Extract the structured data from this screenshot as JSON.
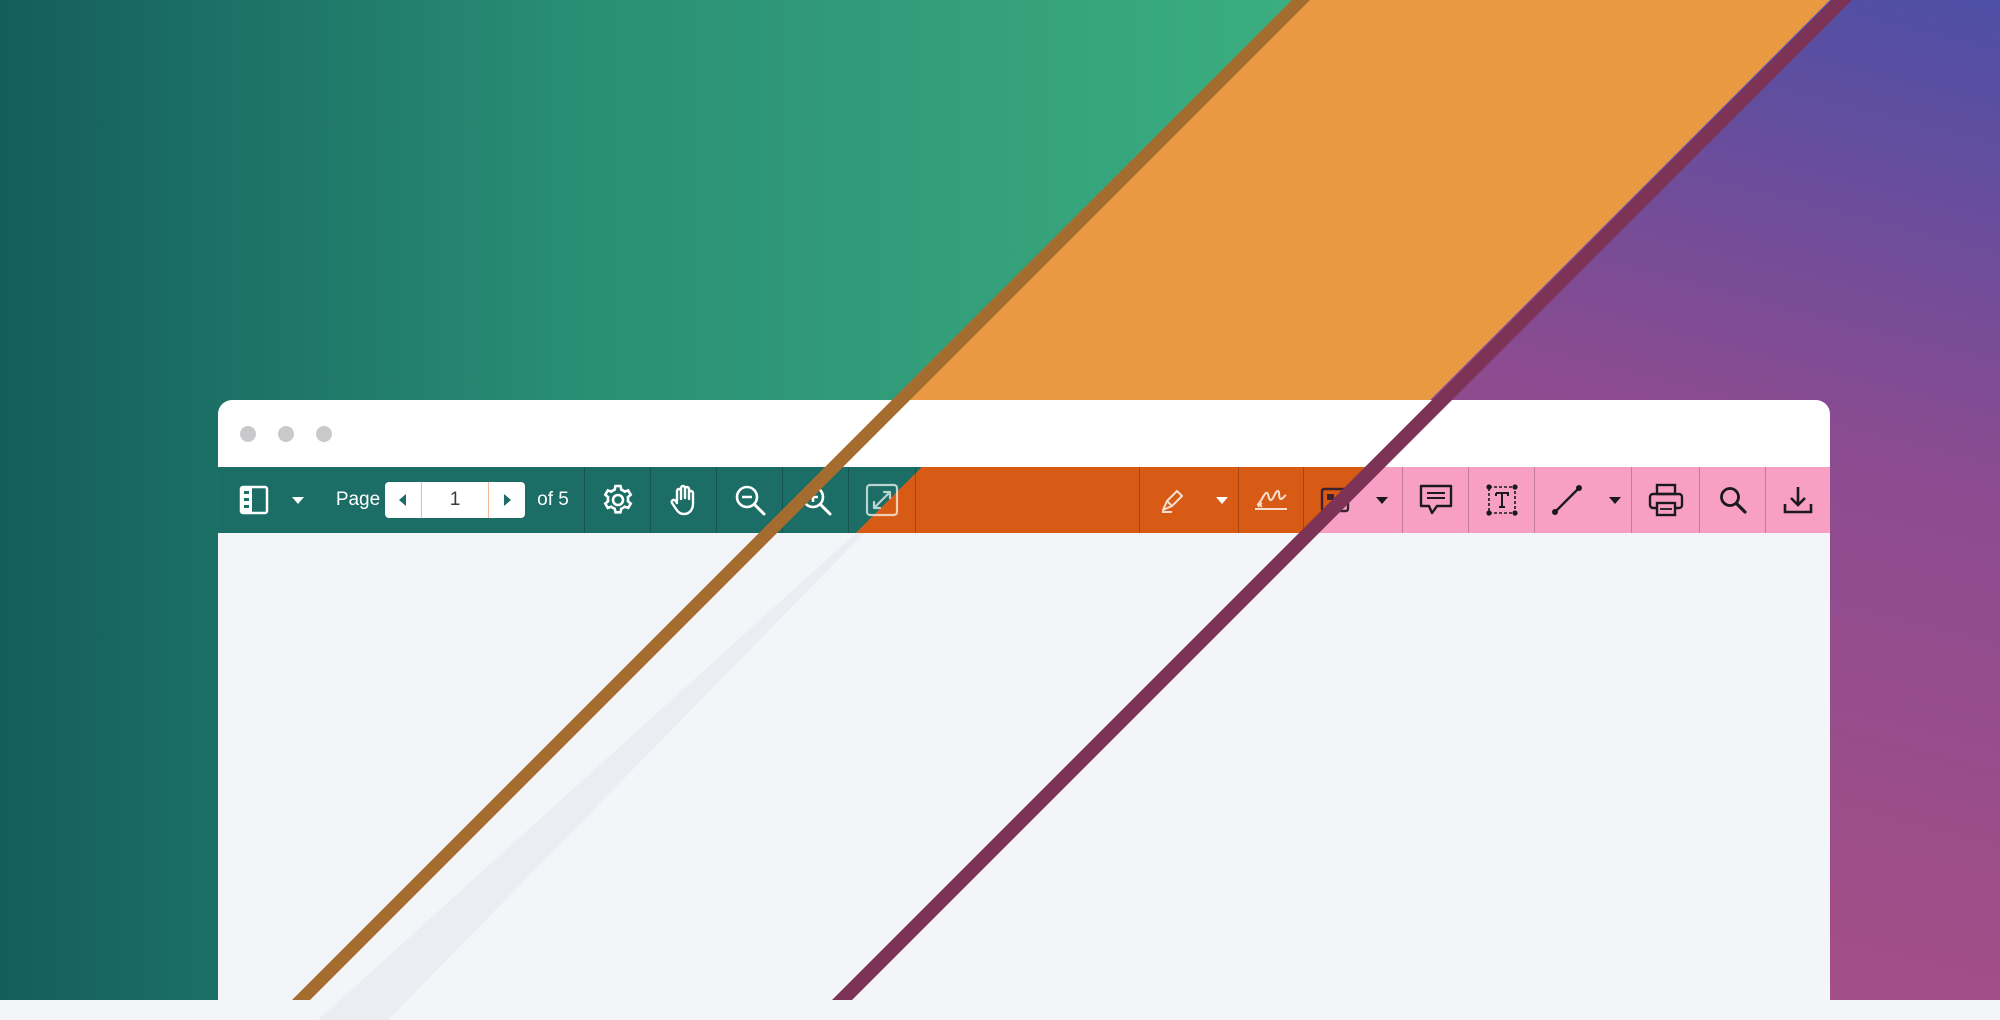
{
  "colors": {
    "teal_dark": "#145d5c",
    "teal_mid": "#2a8f75",
    "teal_light": "#3cae80",
    "orange_band": "#e99941",
    "orange_toolbar": "#d75b14",
    "purple": "#564aa2",
    "magenta": "#9a4b8a",
    "pink_toolbar": "#f8a0c4",
    "window_white": "#ffffff",
    "content_bg": "#f4f5f9",
    "stripe_brown": "#a56c30",
    "stripe_plum": "#7c3355",
    "window_dots": "#c9c9cc"
  },
  "toolbar": {
    "sidebar_toggle_icon": "sidebar-panel-icon",
    "sidebar_menu_icon": "caret-down-icon",
    "page_label": "Page",
    "page_input_value": "1",
    "page_total_label": "of 5",
    "prev_page_icon": "caret-left-icon",
    "next_page_icon": "caret-right-icon",
    "settings_icon": "gear-icon",
    "pan_icon": "hand-icon",
    "zoom_out_icon": "zoom-out-icon",
    "zoom_in_icon": "zoom-in-icon",
    "fit_page_icon": "expand-arrows-icon",
    "freehand_icon": "pen-icon",
    "freehand_menu_icon": "caret-down-icon",
    "signature_icon": "signature-icon",
    "image_icon": "image-icon",
    "image_menu_icon": "caret-down-icon",
    "comment_icon": "comment-icon",
    "text_box_icon": "text-box-icon",
    "line_icon": "line-icon",
    "line_menu_icon": "caret-down-icon",
    "print_icon": "printer-icon",
    "search_icon": "search-icon",
    "download_icon": "download-icon"
  }
}
